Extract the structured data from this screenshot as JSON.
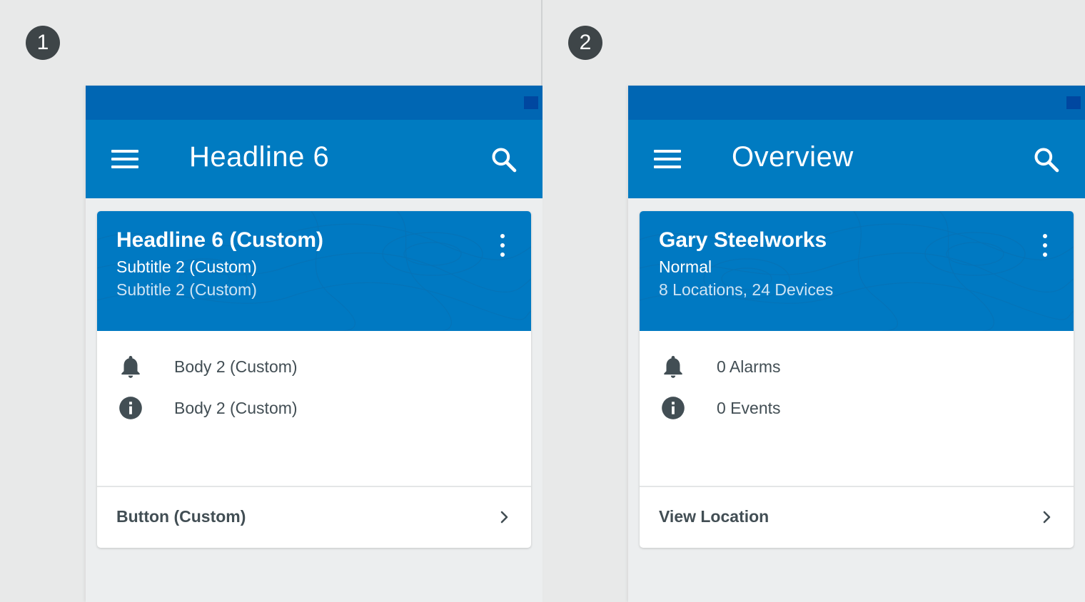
{
  "variants": [
    {
      "step": "1",
      "app_title": "Headline 6",
      "card": {
        "title": "Headline 6 (Custom)",
        "subtitle": "Subtitle 2 (Custom)",
        "subtitle2": "Subtitle 2 (Custom)",
        "rows": [
          {
            "icon": "bell-icon",
            "text": "Body 2 (Custom)"
          },
          {
            "icon": "info-icon",
            "text": "Body 2 (Custom)"
          }
        ],
        "action_label": "Button (Custom)"
      }
    },
    {
      "step": "2",
      "app_title": "Overview",
      "card": {
        "title": "Gary Steelworks",
        "subtitle": "Normal",
        "subtitle2": "8 Locations, 24 Devices",
        "rows": [
          {
            "icon": "bell-icon",
            "text": "0 Alarms"
          },
          {
            "icon": "info-icon",
            "text": "0 Events"
          }
        ],
        "action_label": "View Location"
      }
    }
  ],
  "colors": {
    "status_bar": "#0066b3",
    "app_bar": "#007bc1",
    "card_header": "#0079c2",
    "text_dark": "#424e54",
    "icon_gray": "#424e54",
    "background": "#e8e9e9"
  }
}
